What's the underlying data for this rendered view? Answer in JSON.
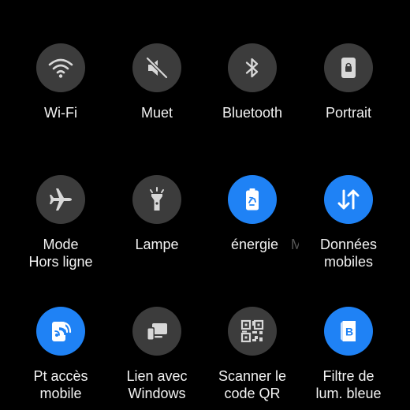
{
  "colors": {
    "background": "#000000",
    "tile_off": "#3c3c3c",
    "tile_on": "#1f82f5",
    "icon_off": "#d8d8d8",
    "icon_on": "#ffffff",
    "label": "#f2f2f2"
  },
  "tiles": [
    {
      "id": "wifi",
      "icon": "wifi-icon",
      "state": "off",
      "label_lines": [
        "Wi-Fi"
      ]
    },
    {
      "id": "mute",
      "icon": "mute-icon",
      "state": "off",
      "label_lines": [
        "Muet"
      ]
    },
    {
      "id": "bluetooth",
      "icon": "bluetooth-icon",
      "state": "off",
      "label_lines": [
        "Bluetooth"
      ]
    },
    {
      "id": "portrait",
      "icon": "rotation-lock-icon",
      "state": "off",
      "label_lines": [
        "Portrait"
      ]
    },
    {
      "id": "airplane",
      "icon": "airplane-icon",
      "state": "off",
      "label_lines": [
        "Mode",
        "Hors ligne"
      ]
    },
    {
      "id": "flashlight",
      "icon": "flashlight-icon",
      "state": "off",
      "label_lines": [
        "Lampe"
      ]
    },
    {
      "id": "power-saving",
      "icon": "battery-saver-icon",
      "state": "on",
      "label_lines": [
        "énergie"
      ],
      "trailing_fragment": "M"
    },
    {
      "id": "mobile-data",
      "icon": "data-arrows-icon",
      "state": "on",
      "label_lines": [
        "Données",
        "mobiles"
      ]
    },
    {
      "id": "hotspot",
      "icon": "hotspot-icon",
      "state": "on",
      "label_lines": [
        "Pt accès",
        "mobile"
      ]
    },
    {
      "id": "link-windows",
      "icon": "link-windows-icon",
      "state": "off",
      "label_lines": [
        "Lien avec",
        "Windows"
      ]
    },
    {
      "id": "qr-scanner",
      "icon": "qr-code-icon",
      "state": "off",
      "label_lines": [
        "Scanner le",
        "code QR"
      ]
    },
    {
      "id": "blue-light",
      "icon": "blue-light-filter-icon",
      "state": "on",
      "label_lines": [
        "Filtre de",
        "lum. bleue"
      ]
    }
  ]
}
